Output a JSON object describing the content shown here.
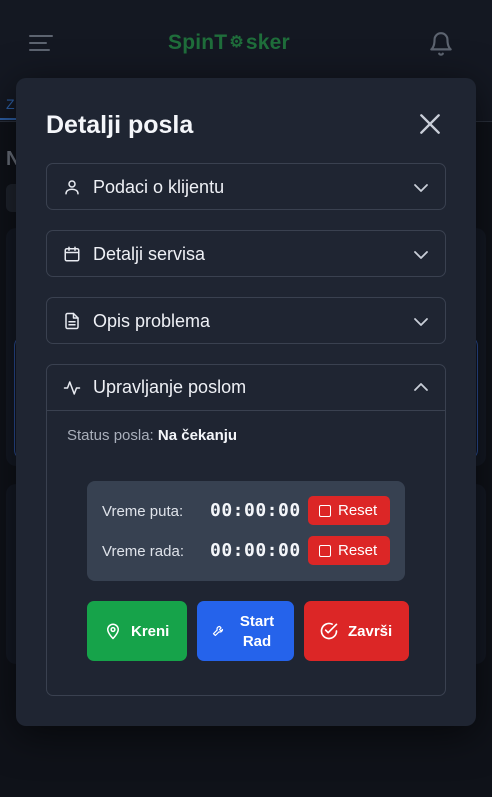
{
  "app": {
    "logo_text": "SpinT",
    "logo_text_end": "sker",
    "bg_tab_label": "Z",
    "bg_heading": "N"
  },
  "modal": {
    "title": "Detalji posla",
    "sections": [
      {
        "label": "Podaci o klijentu",
        "icon": "user-icon"
      },
      {
        "label": "Detalji servisa",
        "icon": "calendar-icon"
      },
      {
        "label": "Opis problema",
        "icon": "document-icon"
      },
      {
        "label": "Upravljanje poslom",
        "icon": "activity-icon"
      }
    ],
    "status_label": "Status posla:",
    "status_value": "Na čekanju",
    "timers": [
      {
        "label": "Vreme puta:",
        "value": "00:00:00",
        "reset_label": "Reset"
      },
      {
        "label": "Vreme rada:",
        "value": "00:00:00",
        "reset_label": "Reset"
      }
    ],
    "actions": {
      "kreni": "Kreni",
      "start_line1": "Start",
      "start_line2": "Rad",
      "zavrsi": "Završi"
    }
  },
  "colors": {
    "background": "#0f1219",
    "modal": "#1f2532",
    "green": "#16a34a",
    "blue": "#2563eb",
    "red": "#dc2626",
    "logo": "#1f6e3b"
  }
}
